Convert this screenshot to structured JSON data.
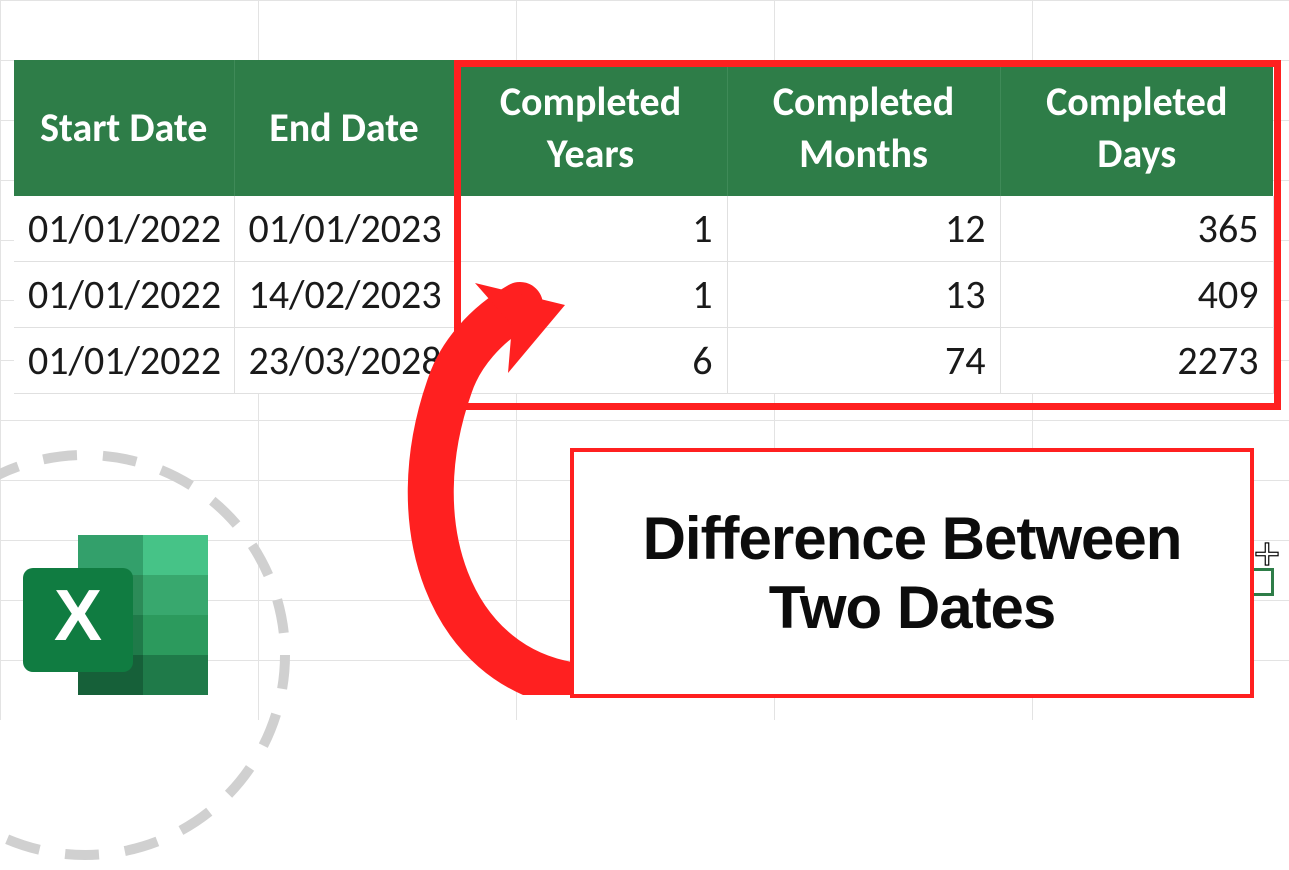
{
  "headers": {
    "start_date": "Start Date",
    "end_date": "End Date",
    "years": "Completed Years",
    "months": "Completed Months",
    "days": "Completed Days"
  },
  "rows": [
    {
      "start": "01/01/2022",
      "end": "01/01/2023",
      "years": "1",
      "months": "12",
      "days": "365"
    },
    {
      "start": "01/01/2022",
      "end": "14/02/2023",
      "years": "1",
      "months": "13",
      "days": "409"
    },
    {
      "start": "01/01/2022",
      "end": "23/03/2028",
      "years": "6",
      "months": "74",
      "days": "2273"
    }
  ],
  "caption": "Difference Between Two Dates",
  "icons": {
    "app": "X",
    "arrow_color": "#ff2020",
    "highlight_color": "#ff2020"
  },
  "chart_data": {
    "type": "table",
    "title": "Date difference table",
    "columns": [
      "Start Date",
      "End Date",
      "Completed Years",
      "Completed Months",
      "Completed Days"
    ],
    "data": [
      [
        "01/01/2022",
        "01/01/2023",
        1,
        12,
        365
      ],
      [
        "01/01/2022",
        "14/02/2023",
        1,
        13,
        409
      ],
      [
        "01/01/2022",
        "23/03/2028",
        6,
        74,
        2273
      ]
    ]
  }
}
